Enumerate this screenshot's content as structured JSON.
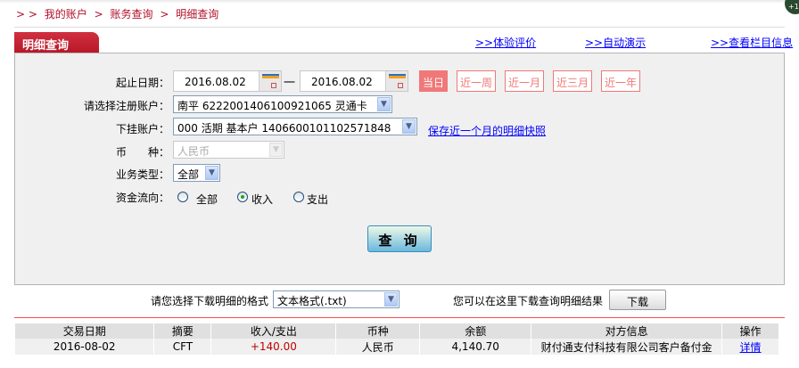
{
  "breadcrumb": [
    "> >",
    "我的账户",
    ">",
    "账务查询",
    ">",
    "明细查询"
  ],
  "notification_badge": "+1",
  "tab_title": "明细查询",
  "top_links": [
    ">>体验评价",
    ">>自动演示",
    ">>查看栏目信息"
  ],
  "form": {
    "date_label": "起止日期：",
    "start_date": "2016.08.02",
    "dash": "一",
    "end_date": "2016.08.02",
    "quick_ranges": [
      "当日",
      "近一周",
      "近一月",
      "近三月",
      "近一年"
    ],
    "quick_selected": "当日",
    "account_label": "请选择注册账户：",
    "account_value": "南平  6222001406100921065 灵通卡",
    "sub_account_label": "下挂账户：",
    "sub_account_value": "000 活期 基本户 1406600101102571848",
    "snapshot_link": "保存近一个月的明细快照",
    "currency_label": "币　　种：",
    "currency_value": "人民币",
    "type_label": "业务类型：",
    "type_value": "全部",
    "flow_label": "资金流向：",
    "flow_options": [
      "全部",
      "收入",
      "支出"
    ],
    "flow_selected": "收入",
    "query_button": "查 询"
  },
  "download": {
    "format_label": "请您选择下载明细的格式",
    "format_value": "文本格式(.txt)",
    "hint": "您可以在这里下载查询明细结果",
    "button": "下载"
  },
  "table": {
    "headers": [
      "交易日期",
      "摘要",
      "收入/支出",
      "币种",
      "余额",
      "对方信息",
      "操作"
    ],
    "rows": [
      [
        "2016-08-02",
        "CFT",
        "+140.00",
        "人民币",
        "4,140.70",
        "财付通支付科技有限公司客户备付金",
        "详情"
      ]
    ]
  },
  "colors": {
    "brand_red": "#b81828",
    "quick_range": "#f07878",
    "income": "#c00000",
    "link": "#0000ff"
  }
}
